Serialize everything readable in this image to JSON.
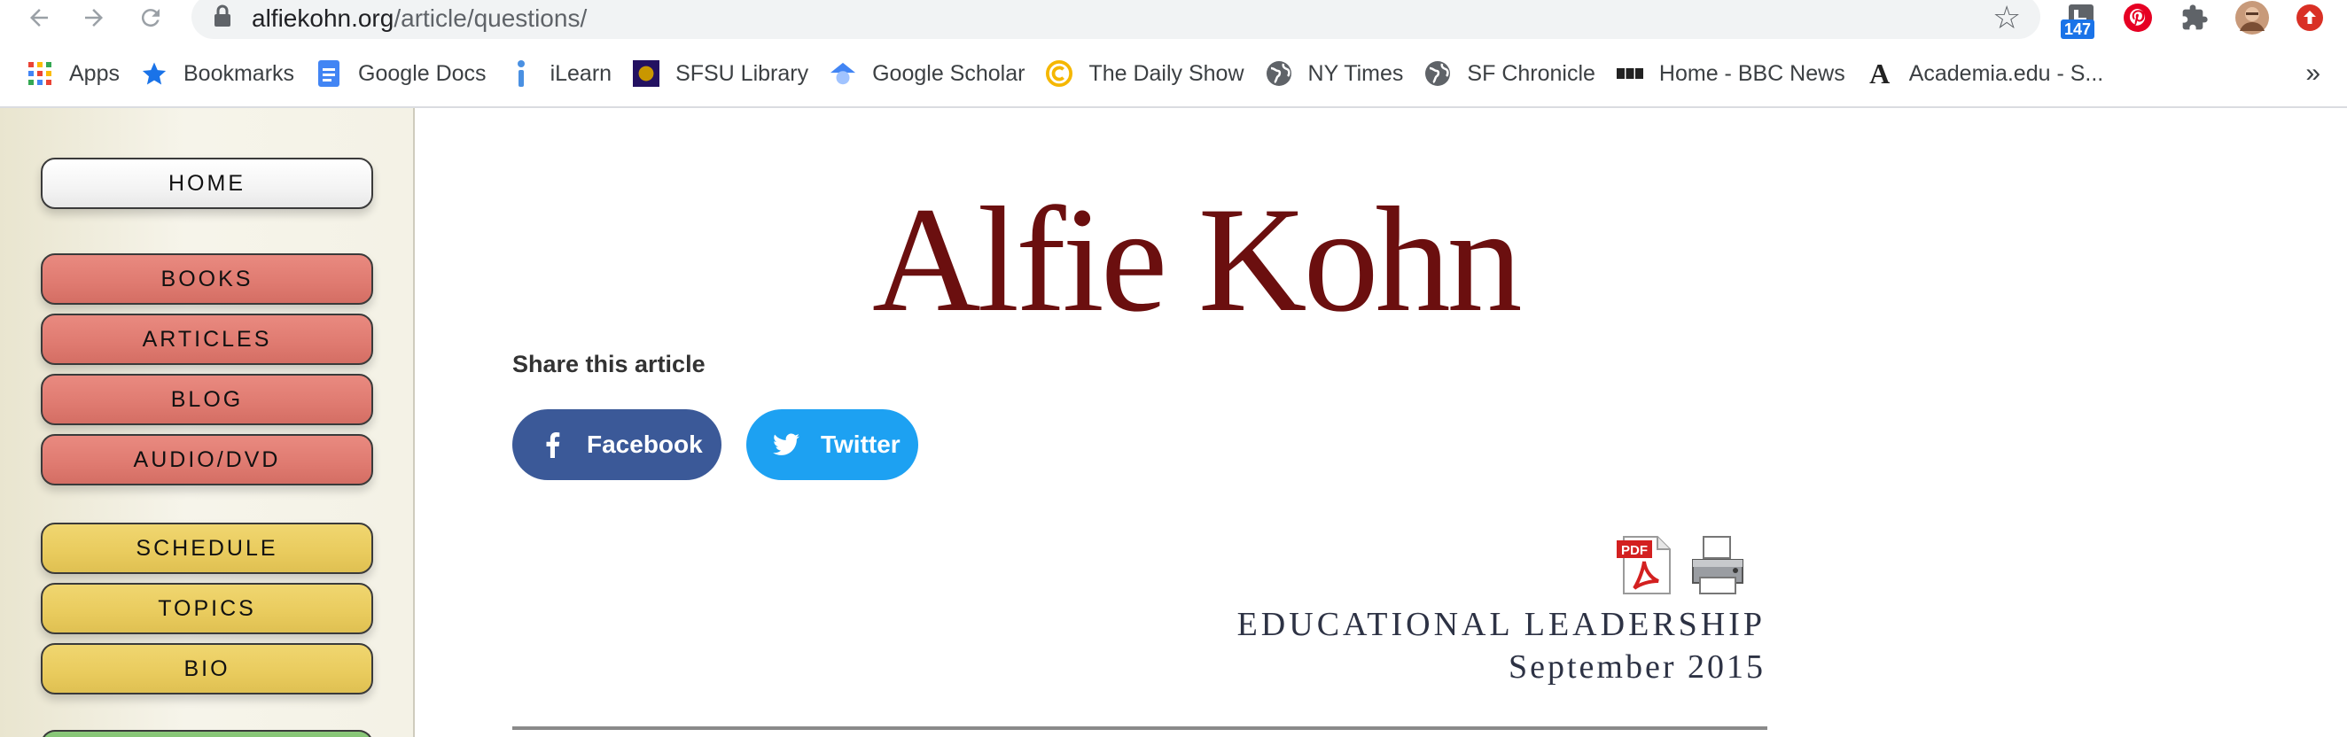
{
  "browser": {
    "url_domain": "alfiekohn.org",
    "url_path": "/article/questions/",
    "extension_badge": "147",
    "more_bookmarks_glyph": "»"
  },
  "bookmarks": [
    {
      "label": "Apps",
      "icon": "apps-grid-icon"
    },
    {
      "label": "Bookmarks",
      "icon": "bookmark-star-icon"
    },
    {
      "label": "Google Docs",
      "icon": "google-docs-icon"
    },
    {
      "label": "iLearn",
      "icon": "info-i-icon"
    },
    {
      "label": "SFSU Library",
      "icon": "sfsu-library-icon"
    },
    {
      "label": "Google Scholar",
      "icon": "google-scholar-icon"
    },
    {
      "label": "The Daily Show",
      "icon": "daily-show-icon"
    },
    {
      "label": "NY Times",
      "icon": "globe-icon"
    },
    {
      "label": "SF Chronicle",
      "icon": "globe-icon"
    },
    {
      "label": "Home - BBC News",
      "icon": "bbc-icon"
    },
    {
      "label": "Academia.edu - S...",
      "icon": "academia-icon"
    }
  ],
  "sidebar": {
    "home": "HOME",
    "books": "BOOKS",
    "articles": "ARTICLES",
    "blog": "BLOG",
    "audio_dvd": "AUDIO/DVD",
    "schedule": "SCHEDULE",
    "topics": "TOPICS",
    "bio": "BIO"
  },
  "main": {
    "site_title": "Alfie Kohn",
    "share_heading": "Share this article",
    "facebook_label": "Facebook",
    "twitter_label": "Twitter",
    "pdf_label": "PDF",
    "publication": "EDUCATIONAL LEADERSHIP",
    "date": "September 2015"
  },
  "colors": {
    "title": "#6b0f0f",
    "facebook": "#3b5998",
    "twitter": "#1da1f2",
    "nav_red": "#df7a70",
    "nav_yellow": "#e9cb5d"
  }
}
